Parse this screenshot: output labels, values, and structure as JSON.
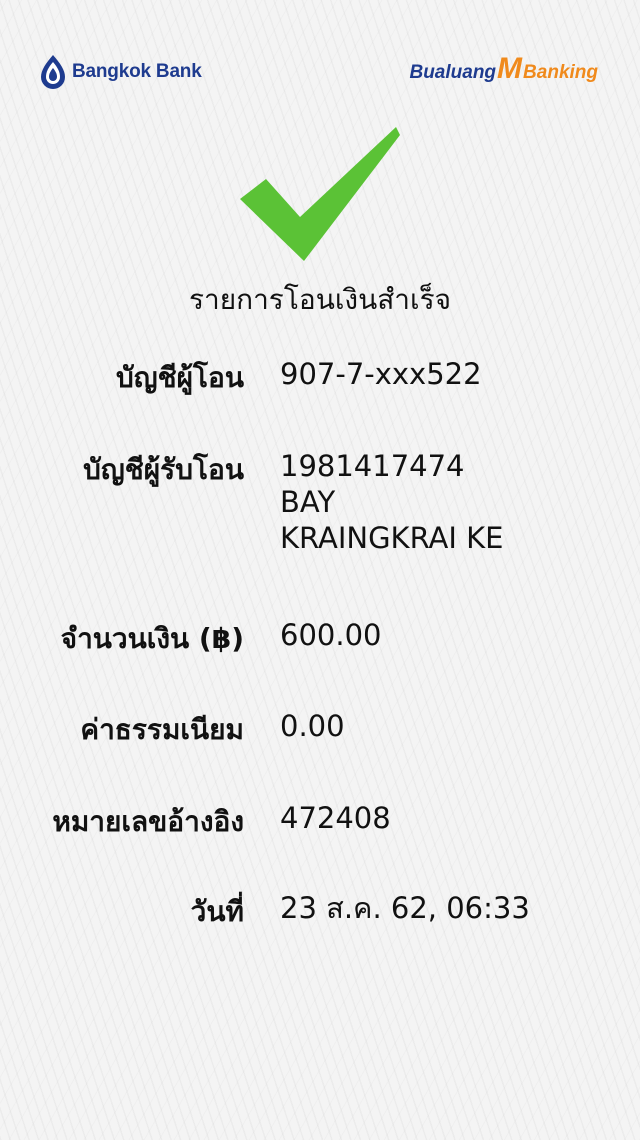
{
  "header": {
    "bank_name": "Bangkok Bank",
    "app_brand_left": "Bualuang",
    "app_brand_m": "M",
    "app_brand_right": "Banking",
    "brand_color": "#1e3b8f",
    "accent_color": "#f08a1c"
  },
  "status": {
    "icon": "checkmark-icon",
    "icon_color": "#5bc236",
    "title": "รายการโอนเงินสำเร็จ"
  },
  "details": {
    "from_account_label": "บัญชีผู้โอน",
    "from_account_value": "907-7-xxx522",
    "to_account_label": "บัญชีผู้รับโอน",
    "to_account_number": "1981417474",
    "to_account_bank": "BAY",
    "to_account_name": "KRAINGKRAI KE",
    "amount_label": "จำนวนเงิน (฿)",
    "amount_value": "600.00",
    "fee_label": "ค่าธรรมเนียม",
    "fee_value": "0.00",
    "reference_label": "หมายเลขอ้างอิง",
    "reference_value": "472408",
    "date_label": "วันที่",
    "date_value": "23 ส.ค. 62, 06:33"
  }
}
